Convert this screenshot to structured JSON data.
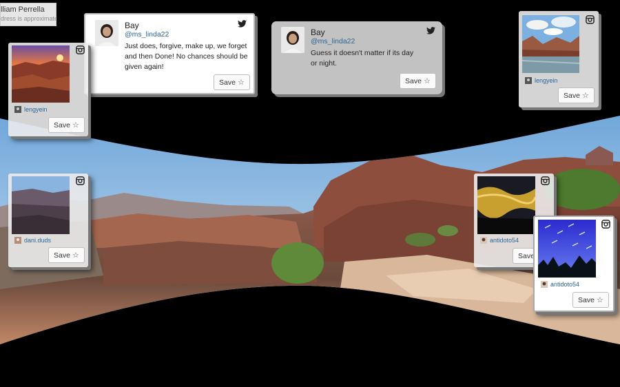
{
  "location": {
    "name": "lliam Perrella",
    "note": "dress is approximate"
  },
  "tweets": [
    {
      "name": "Bay",
      "handle": "@ms_linda22",
      "text": "Just does, forgive, make up, we forget and then Done! No chances should be given again!",
      "save_label": "Save",
      "icon": "twitter-icon"
    },
    {
      "name": "Bay",
      "handle": "@ms_linda22",
      "text": "Guess it doesn't matter if its day or night.",
      "save_label": "Save",
      "icon": "twitter-icon"
    }
  ],
  "instagram_posts": [
    {
      "user": "lengyein",
      "save_label": "Save",
      "icon": "instagram-icon",
      "photo": "canyon-sunset"
    },
    {
      "user": "lengyein",
      "save_label": "Save",
      "icon": "instagram-icon",
      "photo": "river-canyon"
    },
    {
      "user": "dani.duds",
      "save_label": "Save",
      "icon": "instagram-icon",
      "photo": "canyon-rim"
    },
    {
      "user": "antidoto54",
      "save_label": "Save",
      "icon": "instagram-icon",
      "photo": "night-clouds"
    },
    {
      "user": "antidoto54",
      "save_label": "Save",
      "icon": "instagram-icon",
      "photo": "starry-trees"
    }
  ],
  "colors": {
    "link": "#2a6496",
    "card_bg": "#d2d2d2",
    "sky": "#9cc6ea",
    "rock": "#a0604a"
  }
}
